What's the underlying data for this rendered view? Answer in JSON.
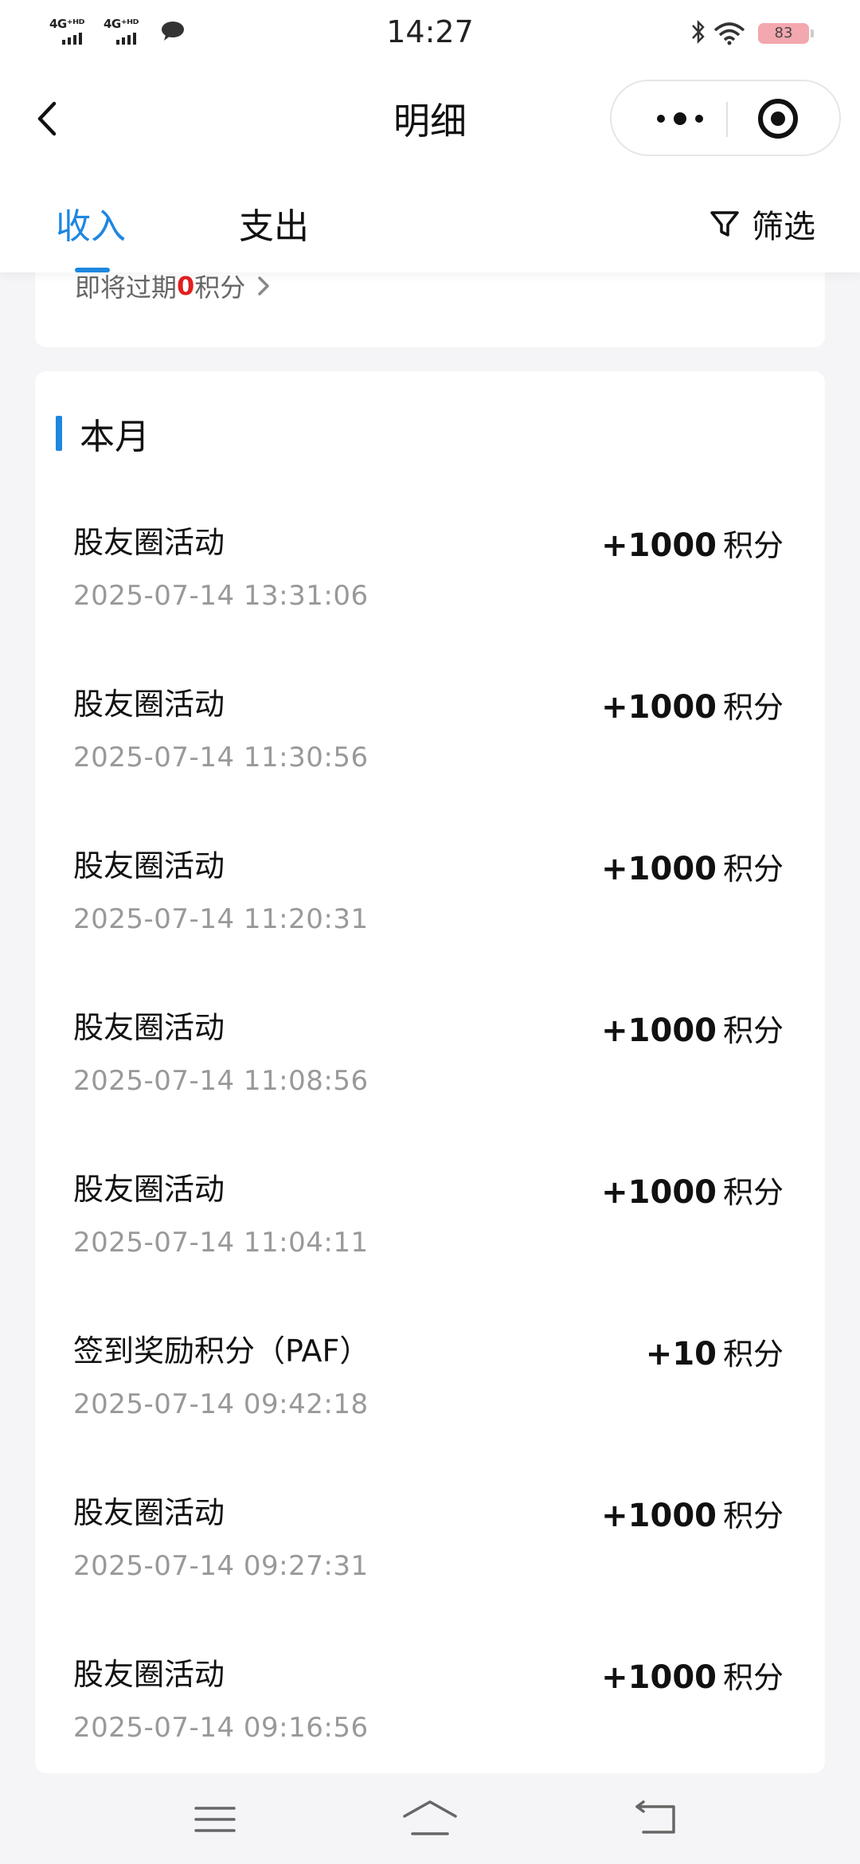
{
  "status_bar": {
    "network_1": "4G⁺ᴴᴰ",
    "network_2": "4G⁺ᴴᴰ",
    "time": "14:27",
    "battery": "83"
  },
  "nav": {
    "title": "明细"
  },
  "tabs": {
    "income": "收入",
    "expense": "支出",
    "filter": "筛选",
    "active": "income"
  },
  "expire_notice": {
    "prefix": "即将过期",
    "count": "0",
    "suffix": "积分"
  },
  "section": {
    "title": "本月"
  },
  "records": [
    {
      "name": "股友圈活动",
      "time": "2025-07-14 13:31:06",
      "amount": "+1000",
      "unit": "积分"
    },
    {
      "name": "股友圈活动",
      "time": "2025-07-14 11:30:56",
      "amount": "+1000",
      "unit": "积分"
    },
    {
      "name": "股友圈活动",
      "time": "2025-07-14 11:20:31",
      "amount": "+1000",
      "unit": "积分"
    },
    {
      "name": "股友圈活动",
      "time": "2025-07-14 11:08:56",
      "amount": "+1000",
      "unit": "积分"
    },
    {
      "name": "股友圈活动",
      "time": "2025-07-14 11:04:11",
      "amount": "+1000",
      "unit": "积分"
    },
    {
      "name": "签到奖励积分（PAF）",
      "time": "2025-07-14 09:42:18",
      "amount": "+10",
      "unit": "积分"
    },
    {
      "name": "股友圈活动",
      "time": "2025-07-14 09:27:31",
      "amount": "+1000",
      "unit": "积分"
    },
    {
      "name": "股友圈活动",
      "time": "2025-07-14 09:16:56",
      "amount": "+1000",
      "unit": "积分"
    }
  ],
  "colors": {
    "accent": "#1e87e0",
    "highlight": "#e02020",
    "muted_text": "#999999",
    "background": "#f5f5f7"
  },
  "icons": [
    "signal-icon",
    "message-icon",
    "bluetooth-icon",
    "wifi-icon",
    "battery-icon",
    "back-arrow-icon",
    "more-icon",
    "target-icon",
    "filter-icon",
    "chevron-right-icon",
    "menu-icon",
    "home-icon",
    "return-icon"
  ]
}
